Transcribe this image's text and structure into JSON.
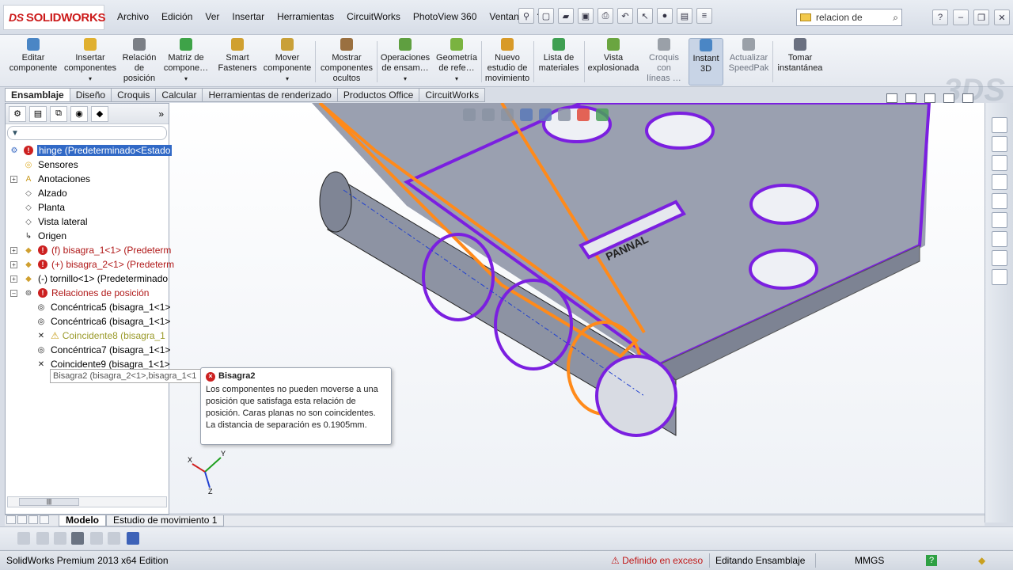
{
  "app": {
    "brand": "SOLIDWORKS",
    "brand_prefix": "DS"
  },
  "menu": [
    "Archivo",
    "Edición",
    "Ver",
    "Insertar",
    "Herramientas",
    "CircuitWorks",
    "PhotoView 360",
    "Ventana",
    "?"
  ],
  "search": {
    "value": "relacion de"
  },
  "ribbon": {
    "commands": [
      {
        "label": "Editar\ncomponente",
        "icon": "edit-component-icon",
        "color": "#4a86c5"
      },
      {
        "label": "Insertar\ncomponentes",
        "icon": "insert-components-icon",
        "color": "#e0b030"
      },
      {
        "label": "Relación\nde\nposición",
        "icon": "mate-icon",
        "color": "#7b7f86"
      },
      {
        "label": "Matriz de\ncompone…",
        "icon": "pattern-icon",
        "color": "#3ea348"
      },
      {
        "label": "Smart\nFasteners",
        "icon": "fasteners-icon",
        "color": "#d0a030"
      },
      {
        "label": "Mover\ncomponente",
        "icon": "move-component-icon",
        "color": "#c9a038"
      },
      {
        "label": "Mostrar\ncomponentes\nocultos",
        "icon": "show-hidden-icon",
        "color": "#9a7040"
      },
      {
        "label": "Operaciones\nde ensam…",
        "icon": "assembly-features-icon",
        "color": "#5f9f40"
      },
      {
        "label": "Geometría\nde refe…",
        "icon": "reference-geometry-icon",
        "color": "#7ab340"
      },
      {
        "label": "Nuevo\nestudio de\nmovimiento",
        "icon": "motion-study-icon",
        "color": "#d89a28"
      },
      {
        "label": "Lista de\nmateriales",
        "icon": "bom-icon",
        "color": "#3f9f52"
      },
      {
        "label": "Vista\nexplosionada",
        "icon": "exploded-view-icon",
        "color": "#6aa540"
      },
      {
        "label": "Croquis\ncon\nlíneas …",
        "icon": "sketch-lines-icon",
        "color": "#9aa0a8"
      },
      {
        "label": "Instant\n3D",
        "icon": "instant3d-icon",
        "color": "#4a86c5"
      },
      {
        "label": "Actualizar\nSpeedPak",
        "icon": "speedpak-icon",
        "color": "#9aa0a8"
      },
      {
        "label": "Tomar\ninstantánea",
        "icon": "snapshot-icon",
        "color": "#6a7080"
      }
    ]
  },
  "tabs": [
    "Ensamblaje",
    "Diseño",
    "Croquis",
    "Calcular",
    "Herramientas de renderizado",
    "Productos Office",
    "CircuitWorks"
  ],
  "tree": {
    "root": "hinge  (Predeterminado<Estado",
    "items": [
      {
        "label": "Sensores",
        "icon": "sensor-icon",
        "level": 1,
        "style": "normal",
        "expander": false
      },
      {
        "label": "Anotaciones",
        "icon": "annotation-icon",
        "level": 1,
        "style": "normal",
        "expander": true
      },
      {
        "label": "Alzado",
        "icon": "plane-icon",
        "level": 1,
        "style": "normal",
        "expander": false
      },
      {
        "label": "Planta",
        "icon": "plane-icon",
        "level": 1,
        "style": "normal",
        "expander": false
      },
      {
        "label": "Vista lateral",
        "icon": "plane-icon",
        "level": 1,
        "style": "normal",
        "expander": false
      },
      {
        "label": "Origen",
        "icon": "origin-icon",
        "level": 1,
        "style": "normal",
        "expander": false
      },
      {
        "label": "(f) bisagra_1<1> (Predeterm",
        "icon": "part-icon",
        "level": 1,
        "style": "red",
        "expander": true
      },
      {
        "label": "(+) bisagra_2<1> (Predeterm",
        "icon": "part-icon",
        "level": 1,
        "style": "red",
        "expander": true
      },
      {
        "label": "(-) tornillo<1> (Predeterminado",
        "icon": "part-icon",
        "level": 1,
        "style": "normal",
        "expander": true
      },
      {
        "label": "Relaciones de posición",
        "icon": "mates-folder-icon",
        "level": 1,
        "style": "red",
        "expander": true
      },
      {
        "label": "Concéntrica5 (bisagra_1<1>",
        "icon": "concentric-icon",
        "level": 2,
        "style": "normal",
        "expander": false
      },
      {
        "label": "Concéntrica6 (bisagra_1<1>",
        "icon": "concentric-icon",
        "level": 2,
        "style": "normal",
        "expander": false
      },
      {
        "label": "Coincidente8 (bisagra_1",
        "icon": "coincident-icon",
        "level": 2,
        "style": "olive",
        "expander": false
      },
      {
        "label": "Concéntrica7 (bisagra_1<1>",
        "icon": "concentric-icon",
        "level": 2,
        "style": "normal",
        "expander": false
      },
      {
        "label": "Coincidente9 (bisagra_1<1>",
        "icon": "coincident-icon",
        "level": 2,
        "style": "normal",
        "expander": false
      }
    ],
    "hover_item": "Bisagra2 (bisagra_2<1>,bisagra_1<1"
  },
  "tooltip": {
    "title": "Bisagra2",
    "body": "Los componentes no pueden moverse a una posición que satisfaga esta relación de posición.  Caras planas no son coincidentes. La distancia de separación es 0.1905mm."
  },
  "model_label": "PANNAL",
  "bottom_tabs": [
    "Modelo",
    "Estudio de movimiento 1"
  ],
  "status": {
    "edition": "SolidWorks Premium 2013 x64 Edition",
    "overdefined": "Definido en exceso",
    "mode": "Editando Ensamblaje",
    "units": "MMGS",
    "help": "?"
  },
  "colors": {
    "part_body": "#9aa0b0",
    "edge_purple": "#7b1fe0",
    "edge_orange": "#ff8a1a",
    "selection_blue": "#3169c6",
    "error_red": "#cc2020"
  }
}
